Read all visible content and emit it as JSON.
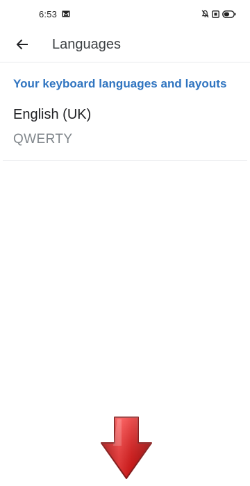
{
  "status_bar": {
    "time": "6:53",
    "icons": [
      "gmail-icon",
      "mute-icon",
      "alarm-icon",
      "battery-icon"
    ]
  },
  "app_bar": {
    "back_icon": "arrow-back-icon",
    "title": "Languages"
  },
  "section": {
    "header": "Your keyboard languages and layouts"
  },
  "languages": [
    {
      "name": "English (UK)",
      "layout": "QWERTY"
    }
  ],
  "overlay": {
    "icon": "red-down-arrow-icon",
    "color": "#e01b1b"
  },
  "colors": {
    "accent": "#2f74c0",
    "primary_text": "#202124",
    "secondary_text": "#80868b",
    "divider": "#e8eaed"
  }
}
